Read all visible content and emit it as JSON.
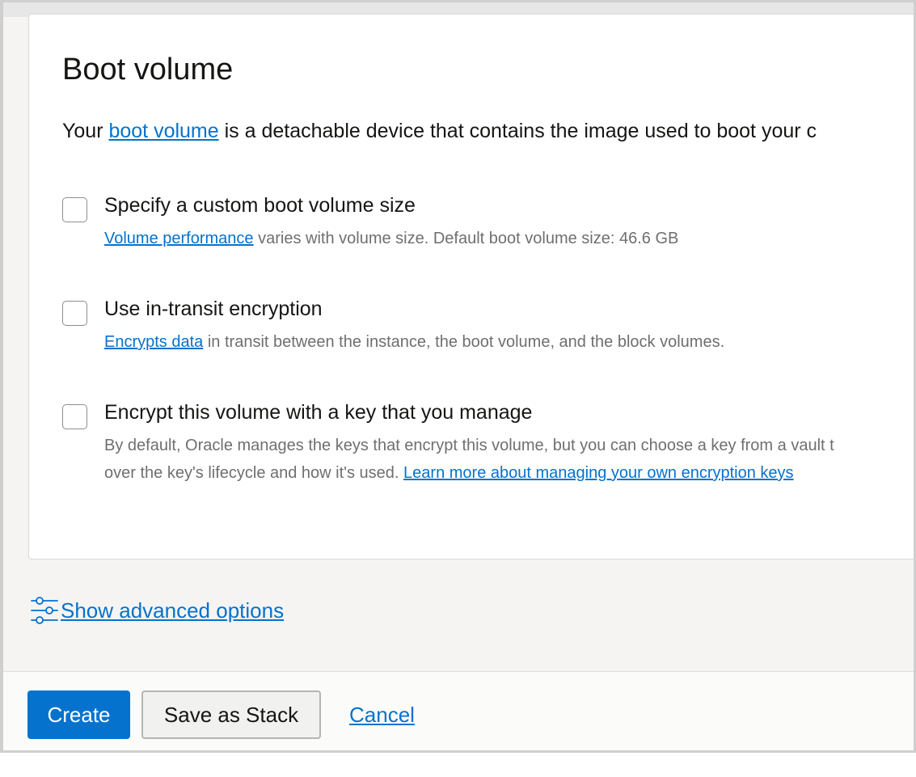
{
  "section": {
    "title": "Boot volume",
    "intro_prefix": "Your ",
    "intro_link": "boot volume",
    "intro_suffix": " is a detachable device that contains the image used to boot your c"
  },
  "options": [
    {
      "label": "Specify a custom boot volume size",
      "help_link": "Volume performance",
      "help_text": " varies with volume size. Default boot volume size: 46.6 GB",
      "checked": false
    },
    {
      "label": "Use in-transit encryption",
      "help_link": "Encrypts data",
      "help_text": " in transit between the instance, the boot volume, and the block volumes.",
      "checked": false
    },
    {
      "label": "Encrypt this volume with a key that you manage",
      "help_line1": "By default, Oracle manages the keys that encrypt this volume, but you can choose a key from a vault t",
      "help_line2": "over the key's lifecycle and how it's used. ",
      "help_link": "Learn more about managing your own encryption keys",
      "checked": false
    }
  ],
  "advanced": {
    "icon": "sliders-icon",
    "label": "Show advanced options"
  },
  "footer": {
    "create_label": "Create",
    "save_stack_label": "Save as Stack",
    "cancel_label": "Cancel"
  },
  "colors": {
    "accent": "#0572ce",
    "text": "#161513",
    "muted": "#6f6f6f"
  }
}
